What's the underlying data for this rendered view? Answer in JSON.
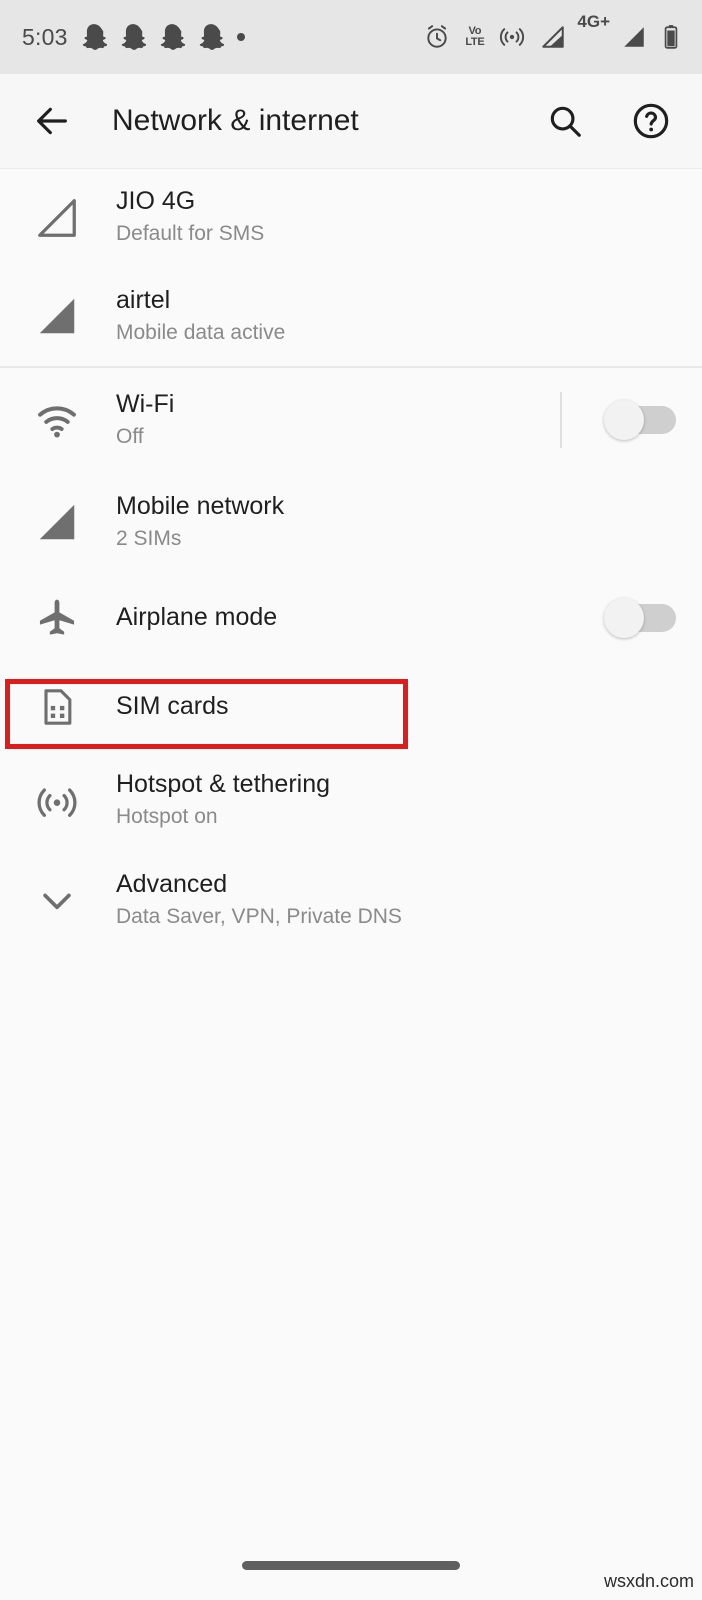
{
  "status_bar": {
    "time": "5:03",
    "notification_icons": [
      "snapchat-ghost",
      "snapchat-ghost",
      "snapchat-ghost",
      "snapchat-ghost",
      "dot"
    ],
    "system_icons": [
      "alarm",
      "volte",
      "hotspot",
      "signal-sim1",
      "4g-plus",
      "signal-sim2",
      "battery"
    ],
    "volte_top": "Vo",
    "volte_bottom": "LTE",
    "network_type": "4G+",
    "background": "#e6e6e6"
  },
  "app_bar": {
    "back_label": "Back",
    "title": "Network & internet",
    "search_label": "Search",
    "help_label": "Help"
  },
  "list": {
    "items": [
      {
        "icon": "signal-outline-icon",
        "title": "JIO 4G",
        "subtitle": "Default for SMS",
        "toggle": null
      },
      {
        "icon": "signal-filled-icon",
        "title": "airtel",
        "subtitle": "Mobile data active",
        "toggle": null
      },
      {
        "icon": "wifi-icon",
        "title": "Wi-Fi",
        "subtitle": "Off",
        "toggle": "off"
      },
      {
        "icon": "signal-filled-icon",
        "title": "Mobile network",
        "subtitle": "2 SIMs",
        "toggle": null
      },
      {
        "icon": "airplane-icon",
        "title": "Airplane mode",
        "subtitle": "",
        "toggle": "off"
      },
      {
        "icon": "sim-card-icon",
        "title": "SIM cards",
        "subtitle": "",
        "toggle": null
      },
      {
        "icon": "hotspot-icon",
        "title": "Hotspot & tethering",
        "subtitle": "Hotspot on",
        "toggle": null
      },
      {
        "icon": "chevron-down-icon",
        "title": "Advanced",
        "subtitle": "Data Saver, VPN, Private DNS",
        "toggle": null
      }
    ]
  },
  "highlight": {
    "target": "SIM cards",
    "color": "#e01b1b"
  },
  "footer": {
    "watermark": "wsxdn.com"
  }
}
